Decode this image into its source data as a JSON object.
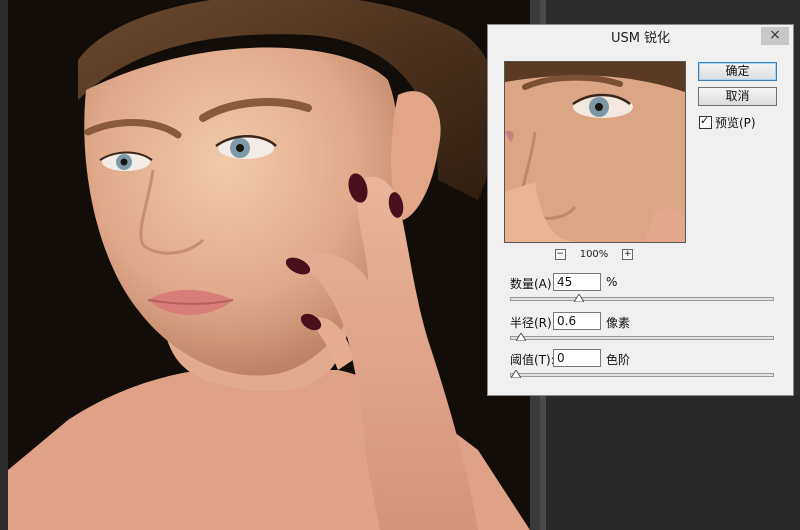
{
  "dialog": {
    "title": "USM 锐化",
    "close_label": "×",
    "ok_label": "确定",
    "cancel_label": "取消",
    "preview_label": "预览(P)",
    "preview_checked": true,
    "zoom": {
      "level": "100%",
      "minus_label": "−",
      "plus_label": "+"
    },
    "params": [
      {
        "label": "数量(A):",
        "value": "45",
        "unit": "%",
        "slider_fraction": 0.25
      },
      {
        "label": "半径(R):",
        "value": "0.6",
        "unit": "像素",
        "slider_fraction": 0.02
      },
      {
        "label": "阈值(T):",
        "value": "0",
        "unit": "色阶",
        "slider_fraction": 0.0
      }
    ]
  },
  "colors": {
    "workspace": "#2b2b2b",
    "dialog_bg": "#f0f0f0",
    "default_button_border": "#3c7fb1",
    "nail_polish": "#4a0f1c"
  }
}
